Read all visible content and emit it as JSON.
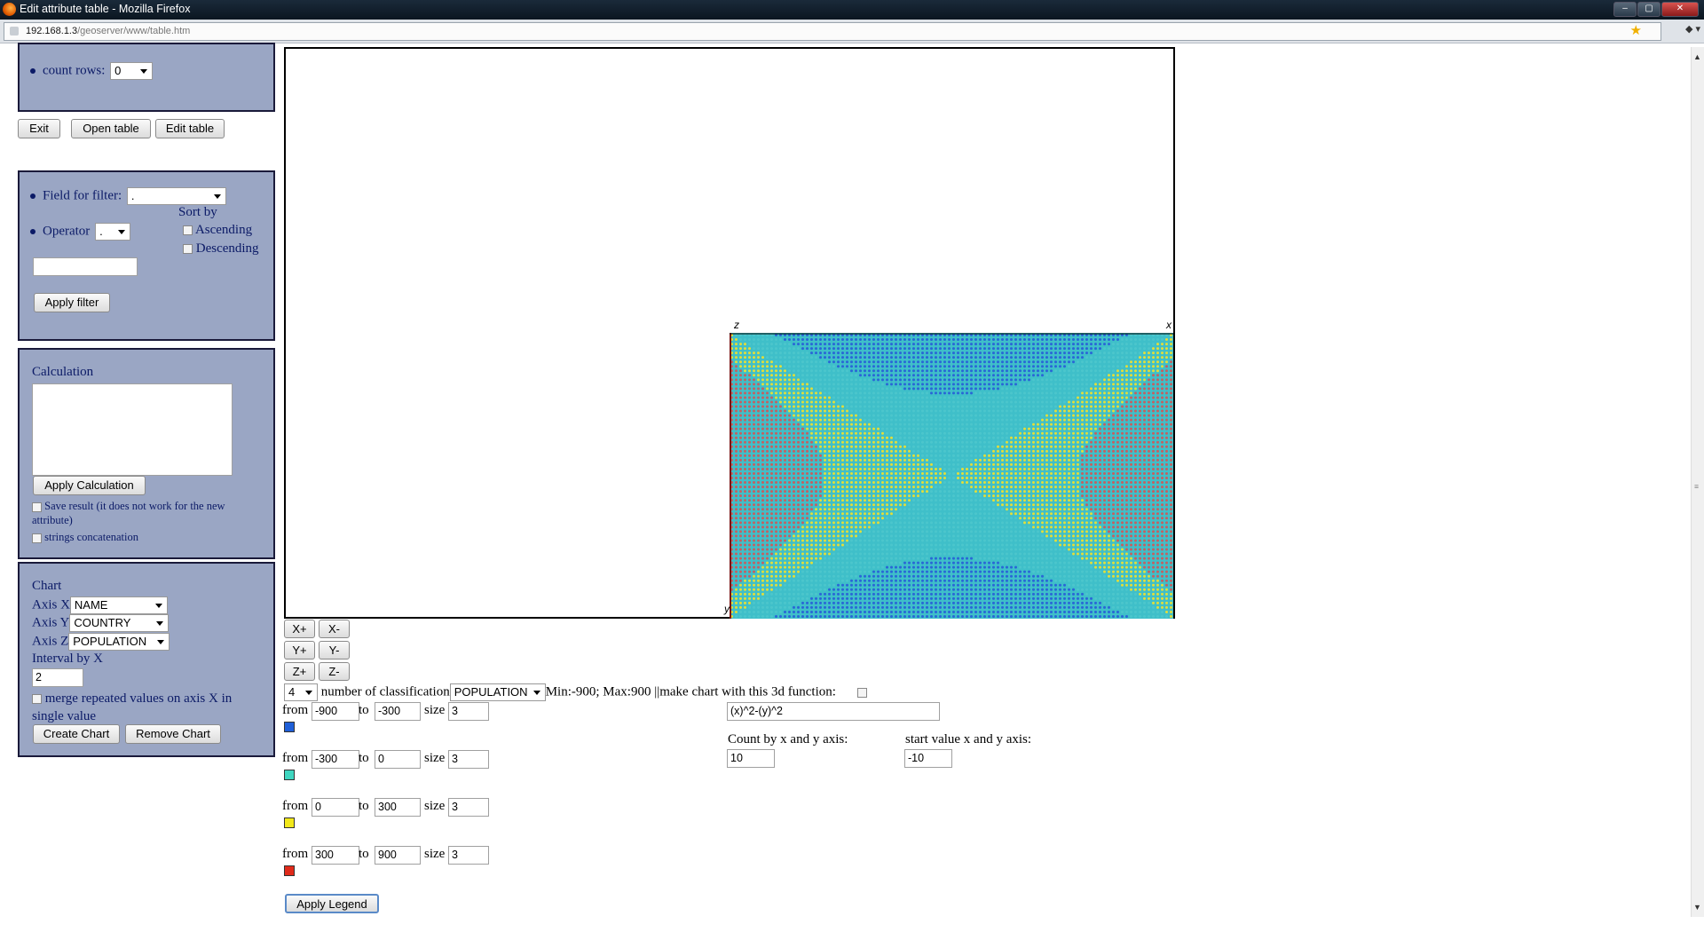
{
  "window": {
    "title": "Edit attribute table - Mozilla Firefox",
    "buttons": [
      "–",
      "▢",
      "✕"
    ]
  },
  "urlbar": {
    "host": "192.168.1.3",
    "path": "/geoserver/www/table.htm"
  },
  "rows_panel": {
    "label": "count rows:",
    "value": "0"
  },
  "top_buttons": {
    "exit": "Exit",
    "open_table": "Open table",
    "edit_table": "Edit table"
  },
  "filter_panel": {
    "field_label": "Field for filter:",
    "field_value": ".",
    "operator_label": "Operator",
    "operator_value": ".",
    "sort_by": "Sort by",
    "ascending": "Ascending",
    "descending": "Descending",
    "filter_value": "",
    "apply": "Apply filter"
  },
  "calc_panel": {
    "title": "Calculation",
    "text": "",
    "apply": "Apply Calculation",
    "save_result": "Save result (it does not work for the new attribute)",
    "concat": "strings concatenation"
  },
  "chart_panel": {
    "title": "Chart",
    "axis_x_label": "Axis X",
    "axis_x_value": "NAME",
    "axis_y_label": "Axis Y",
    "axis_y_value": "COUNTRY",
    "axis_z_label": "Axis Z",
    "axis_z_value": "POPULATION",
    "interval_label": "Interval by X",
    "interval_value": "2",
    "merge_label": "merge repeated values on axis X in single value",
    "create": "Create Chart",
    "remove": "Remove Chart"
  },
  "chart_axes": {
    "z": "z",
    "x": "x",
    "y": "y"
  },
  "nav_buttons": {
    "xp": "X+",
    "xm": "X-",
    "yp": "Y+",
    "ym": "Y-",
    "zp": "Z+",
    "zm": "Z-"
  },
  "classification": {
    "count": "4",
    "label": "number of classification",
    "field": "POPULATION",
    "minmax": "Min:-900; Max:900 ||make chart with this 3d function:",
    "function": "(x)^2-(y)^2",
    "count_label": "Count by x and y axis:",
    "count_value": "10",
    "start_label": "start value x and y axis:",
    "start_value": "-10"
  },
  "legend": [
    {
      "from": "-900",
      "to": "-300",
      "size": "3",
      "color": "#1f5fd8"
    },
    {
      "from": "-300",
      "to": "0",
      "size": "3",
      "color": "#3fd6c0"
    },
    {
      "from": "0",
      "to": "300",
      "size": "3",
      "color": "#f2e81a"
    },
    {
      "from": "300",
      "to": "900",
      "size": "3",
      "color": "#e02a1a"
    }
  ],
  "legend_labels": {
    "from": "from",
    "to": "to",
    "size": "size"
  },
  "apply_legend": "Apply Legend",
  "chart_data": {
    "type": "heatmap",
    "function": "(x)^2-(y)^2",
    "x_range": [
      -30,
      30
    ],
    "y_range": [
      -30,
      30
    ],
    "colors": [
      "#2a66d6",
      "#4cc6cc",
      "#e3de3a",
      "#c46060"
    ],
    "class_bounds": [
      -900,
      -300,
      0,
      300,
      900
    ]
  }
}
